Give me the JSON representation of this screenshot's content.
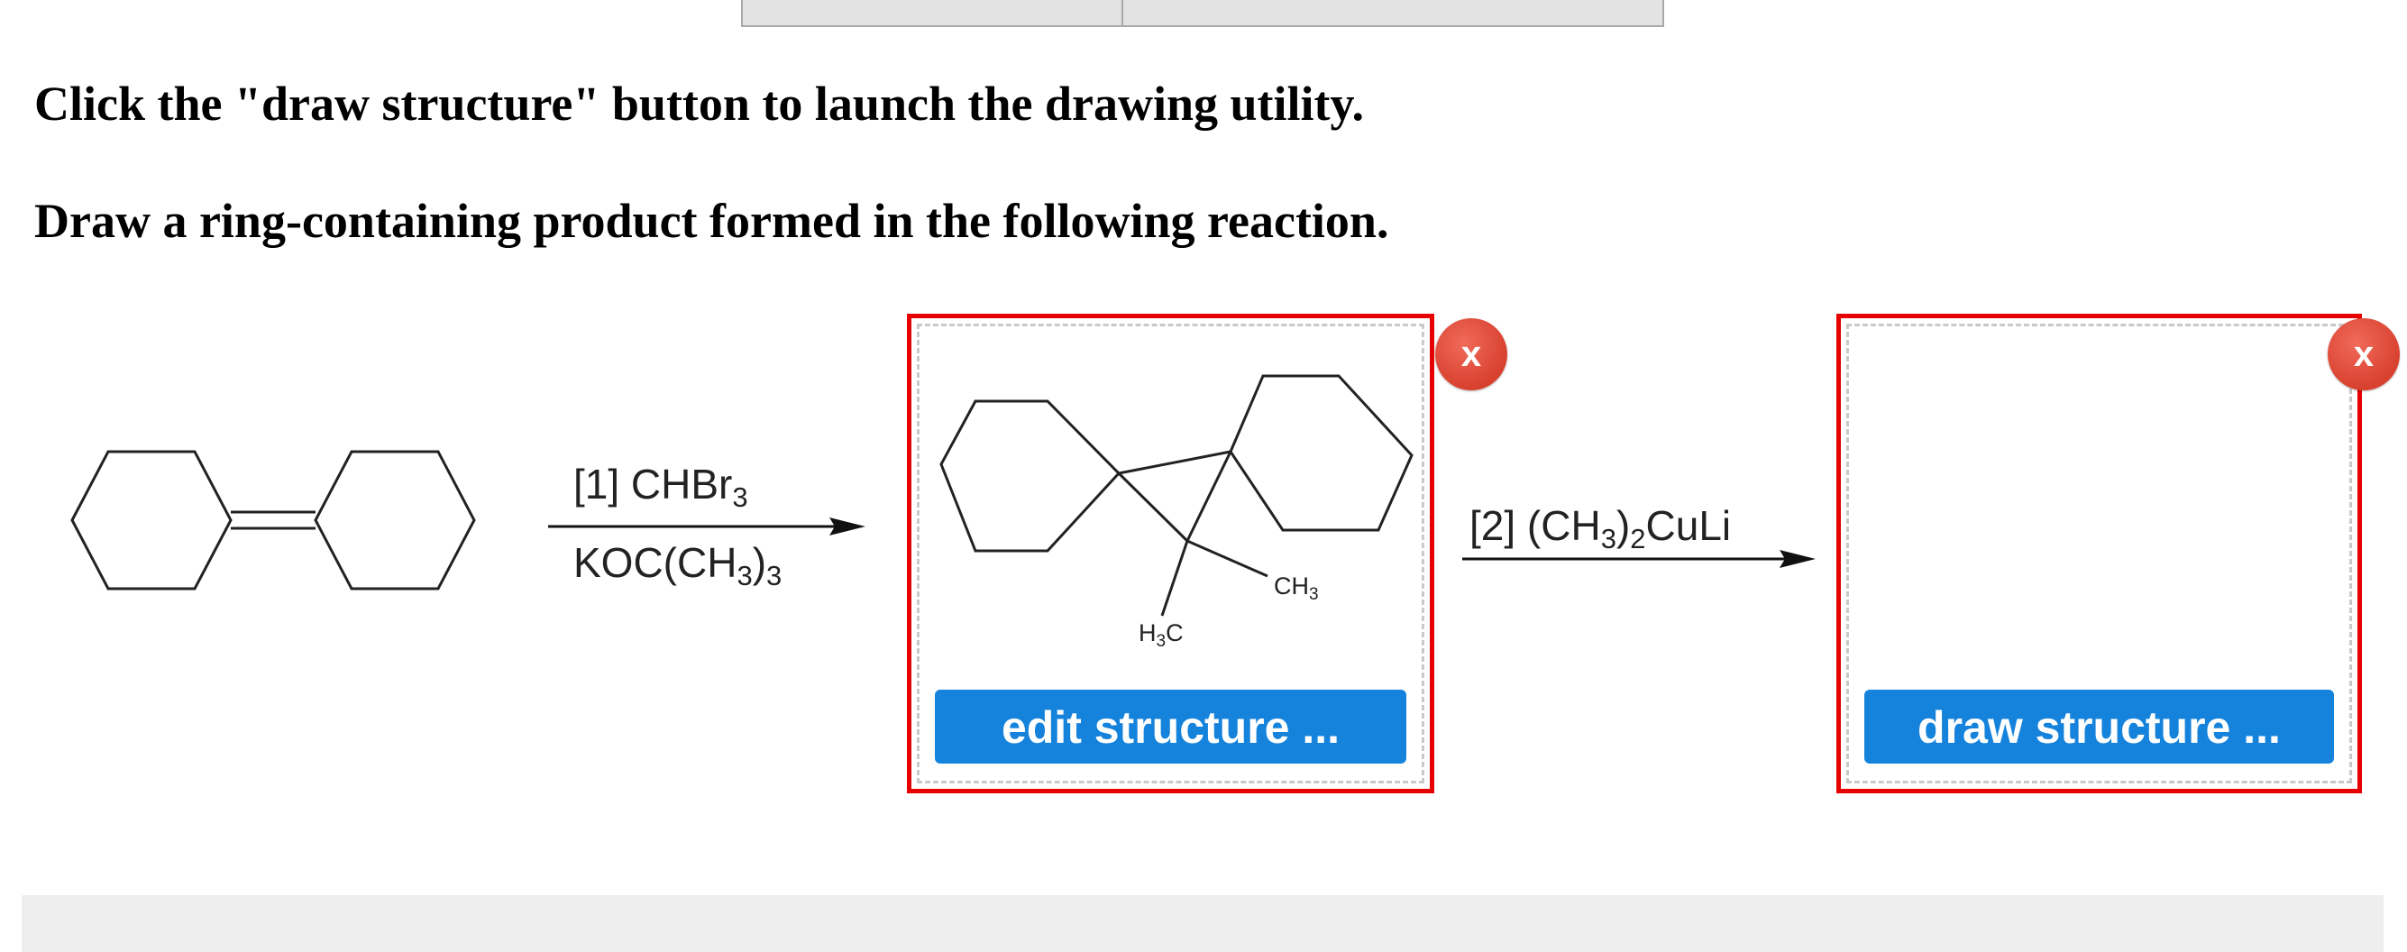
{
  "instructions": {
    "line1": "Click the \"draw structure\" button to launch the drawing utility.",
    "line2": "Draw a ring-containing product formed in the following reaction."
  },
  "reaction": {
    "step1": {
      "reagent_top": "[1] CHBr3",
      "reagent_bottom": "KOC(CH3)3"
    },
    "step2": {
      "reagent": "[2] (CH3)2CuLi"
    },
    "intermediate_labels": {
      "methyl_right": "CH3",
      "methyl_left": "H3C"
    }
  },
  "boxes": {
    "intermediate": {
      "button_label": "edit structure ...",
      "close_label": "x"
    },
    "product": {
      "button_label": "draw structure ...",
      "close_label": "x"
    }
  },
  "colors": {
    "button_blue": "#1583dc",
    "box_border_red": "#e60000",
    "close_red": "#d9412f"
  },
  "icons": {
    "close": "close-x-icon"
  }
}
